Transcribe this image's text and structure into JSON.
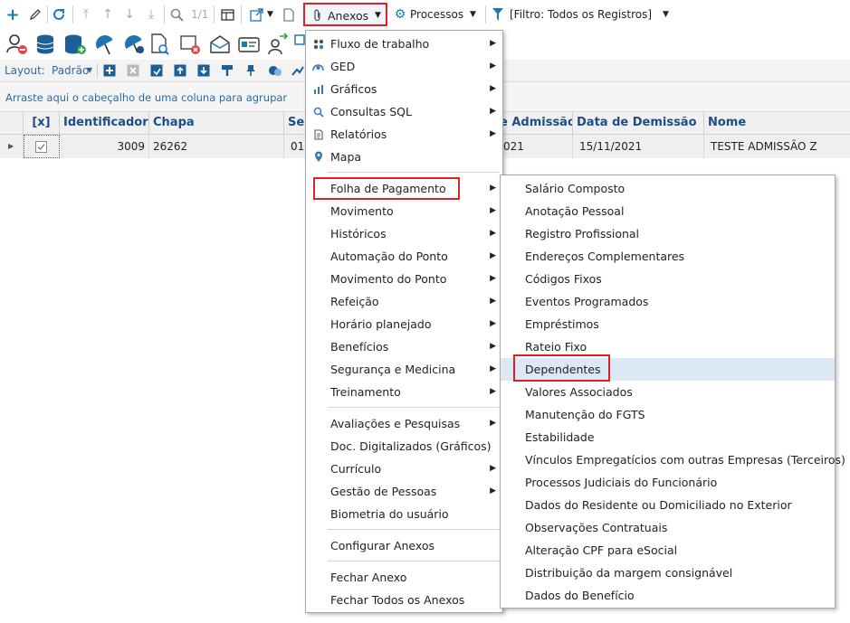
{
  "toolbar": {
    "paging": "1/1",
    "anexos_label": "Anexos",
    "processos_label": "Processos",
    "filter_label": "[Filtro: Todos os Registros]"
  },
  "layoutbar": {
    "layout_label": "Layout:",
    "layout_value": "Padrão"
  },
  "groupbar": {
    "hint": "Arraste aqui o cabeçalho de uma coluna para agrupar"
  },
  "grid": {
    "columns": {
      "check": "[x]",
      "identificador": "Identificador",
      "chapa": "Chapa",
      "se": "Se",
      "admissao": "e Admissão",
      "demissao": "Data de Demissão",
      "nome": "Nome"
    },
    "row": {
      "identificador": "3009",
      "chapa": "26262",
      "se": "01.",
      "admissao": "021",
      "demissao": "15/11/2021",
      "nome": "TESTE ADMISSÃO Z"
    }
  },
  "anexos_menu": {
    "items": [
      {
        "label": "Fluxo de trabalho",
        "icon": "workflow-icon"
      },
      {
        "label": "GED",
        "icon": "ged-icon"
      },
      {
        "label": "Gráficos",
        "icon": "chart-icon"
      },
      {
        "label": "Consultas SQL",
        "icon": "search-icon"
      },
      {
        "label": "Relatórios",
        "icon": "report-icon"
      },
      {
        "label": "Mapa",
        "icon": "map-pin-icon"
      },
      {
        "label": "Folha de Pagamento"
      },
      {
        "label": "Movimento"
      },
      {
        "label": "Históricos"
      },
      {
        "label": "Automação do Ponto"
      },
      {
        "label": "Movimento do Ponto"
      },
      {
        "label": "Refeição"
      },
      {
        "label": "Horário planejado"
      },
      {
        "label": "Benefícios"
      },
      {
        "label": "Segurança e Medicina"
      },
      {
        "label": "Treinamento"
      },
      {
        "label": "Avaliações e Pesquisas"
      },
      {
        "label": "Doc. Digitalizados (Gráficos)"
      },
      {
        "label": "Currículo"
      },
      {
        "label": "Gestão de Pessoas"
      },
      {
        "label": "Biometria do usuário"
      },
      {
        "label": "Configurar Anexos"
      },
      {
        "label": "Fechar Anexo"
      },
      {
        "label": "Fechar Todos os Anexos"
      }
    ]
  },
  "folha_submenu": {
    "items": [
      "Salário Composto",
      "Anotação Pessoal",
      "Registro Profissional",
      "Endereços Complementares",
      "Códigos Fixos",
      "Eventos Programados",
      "Empréstimos",
      "Rateio Fixo",
      "Dependentes",
      "Valores Associados",
      "Manutenção do FGTS",
      "Estabilidade",
      "Vínculos Empregatícios com outras Empresas (Terceiros)",
      "Processos Judiciais do Funcionário",
      "Dados do Residente ou Domiciliado no Exterior",
      "Observações Contratuais",
      "Alteração CPF para eSocial",
      "Distribuição da margem consignável",
      "Dados do Benefício"
    ]
  },
  "colors": {
    "highlight_border": "#e02020",
    "hover_row": "#dce8f6",
    "header_text": "#1b4f86",
    "icon_blue": "#1a7ab8"
  }
}
